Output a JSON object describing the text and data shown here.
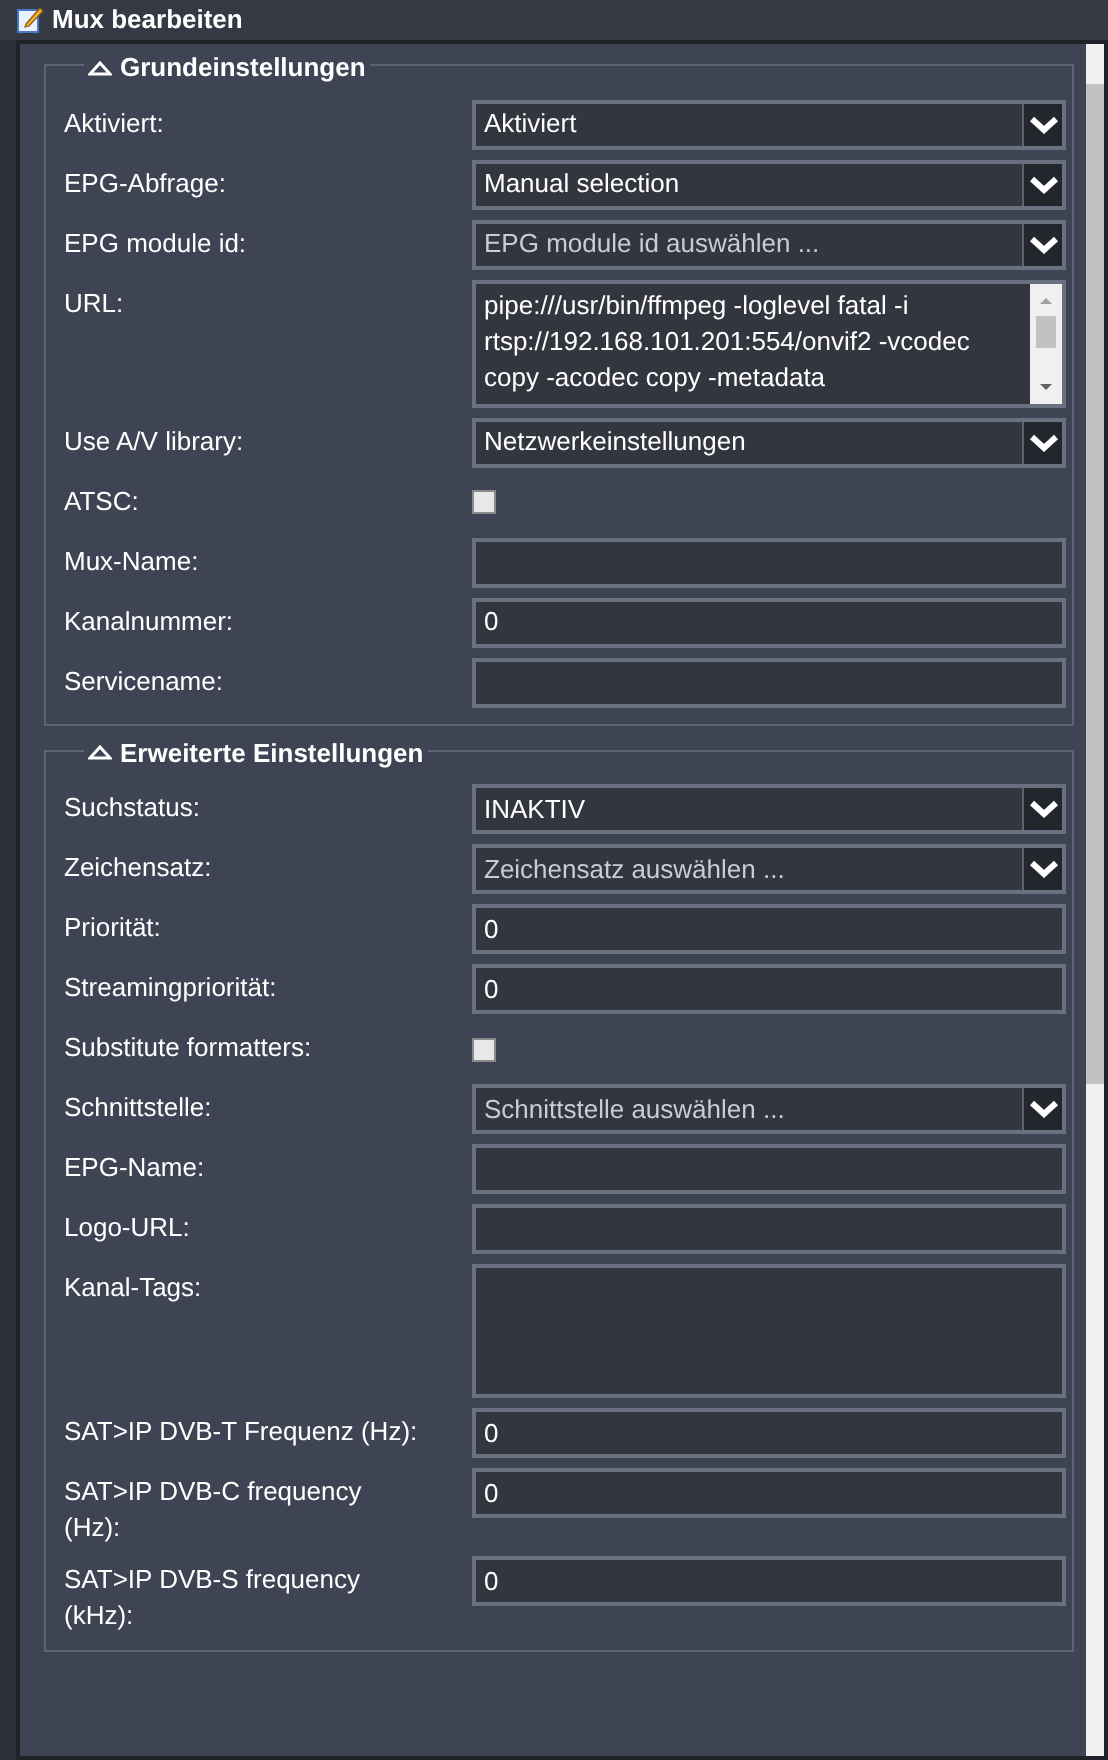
{
  "window": {
    "title": "Mux bearbeiten"
  },
  "sections": [
    {
      "title": "Grundeinstellungen",
      "expanded": true,
      "fields": [
        {
          "kind": "select",
          "label": "Aktiviert:",
          "value": "Aktiviert"
        },
        {
          "kind": "select",
          "label": "EPG-Abfrage:",
          "value": "Manual selection"
        },
        {
          "kind": "select",
          "label": "EPG module id:",
          "placeholder": "EPG module id auswählen ..."
        },
        {
          "kind": "textarea",
          "label": "URL:",
          "value": "pipe:///usr/bin/ffmpeg -loglevel fatal -i rtsp://192.168.101.201:554/onvif2 -vcodec copy -acodec copy -metadata"
        },
        {
          "kind": "select",
          "label": "Use A/V library:",
          "value": "Netzwerkeinstellungen"
        },
        {
          "kind": "checkbox",
          "label": "ATSC:",
          "checked": false
        },
        {
          "kind": "text",
          "label": "Mux-Name:"
        },
        {
          "kind": "text",
          "label": "Kanalnummer:",
          "value": "0"
        },
        {
          "kind": "text",
          "label": "Servicename:"
        }
      ]
    },
    {
      "title": "Erweiterte Einstellungen",
      "expanded": true,
      "fields": [
        {
          "kind": "select",
          "label": "Suchstatus:",
          "value": "INAKTIV"
        },
        {
          "kind": "select",
          "label": "Zeichensatz:",
          "placeholder": "Zeichensatz auswählen ..."
        },
        {
          "kind": "text",
          "label": "Priorität:",
          "value": "0"
        },
        {
          "kind": "text",
          "label": "Streamingpriorität:",
          "value": "0"
        },
        {
          "kind": "checkbox",
          "label": "Substitute formatters:",
          "checked": false
        },
        {
          "kind": "select",
          "label": "Schnittstelle:",
          "placeholder": "Schnittstelle auswählen ..."
        },
        {
          "kind": "text",
          "label": "EPG-Name:"
        },
        {
          "kind": "text",
          "label": "Logo-URL:"
        },
        {
          "kind": "tags",
          "label": "Kanal-Tags:"
        },
        {
          "kind": "text",
          "label": "SAT>IP DVB-T Frequenz (Hz):",
          "value": "0"
        },
        {
          "kind": "text",
          "label": "SAT>IP DVB-C frequency (Hz):",
          "value": "0"
        },
        {
          "kind": "text",
          "label": "SAT>IP DVB-S frequency (kHz):",
          "value": "0"
        }
      ]
    }
  ]
}
